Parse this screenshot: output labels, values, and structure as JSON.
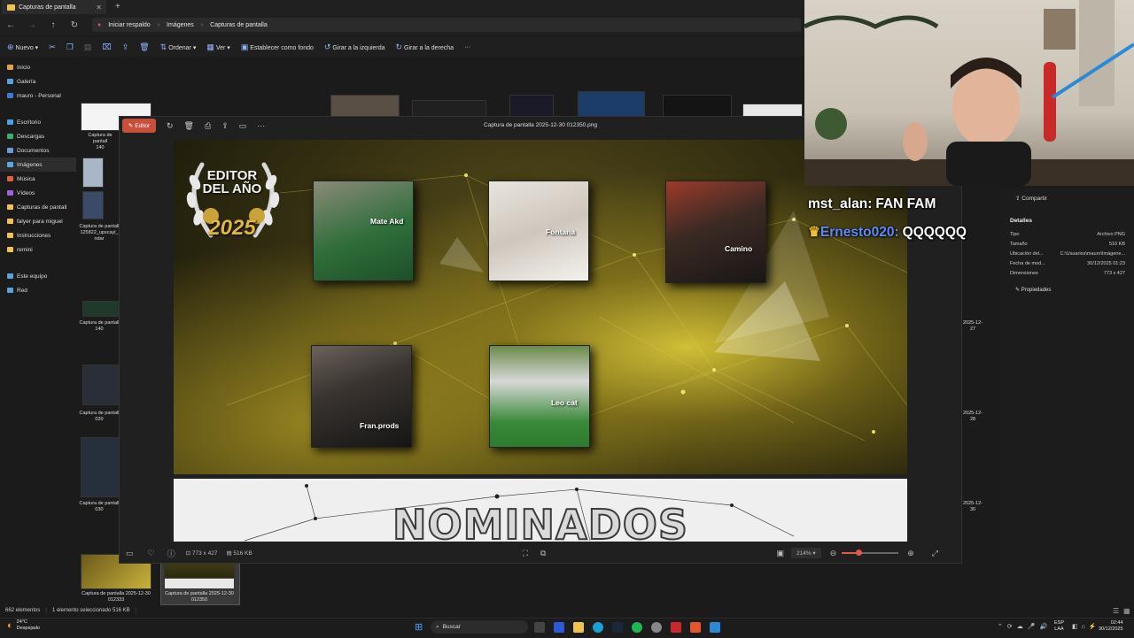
{
  "explorer": {
    "tab_title": "Capturas de pantalla",
    "breadcrumb": [
      "Iniciar respaldo",
      "Imágenes",
      "Capturas de pantalla"
    ],
    "toolbar": {
      "new": "Nuevo",
      "sort": "Ordenar",
      "view": "Ver",
      "set_background": "Establecer como fondo",
      "rotate_left": "Girar a la izquierda",
      "rotate_right": "Girar a la derecha",
      "more": "···"
    },
    "sidebar": [
      {
        "label": "Inicio",
        "color": "#e8a040"
      },
      {
        "label": "Galería",
        "color": "#5aa0e0"
      },
      {
        "label": "mauro - Personal",
        "color": "#3b78d8"
      },
      {
        "label": "Escritorio",
        "color": "#4aa0e8"
      },
      {
        "label": "Descargas",
        "color": "#3cb06a"
      },
      {
        "label": "Documentos",
        "color": "#6c9ad8"
      },
      {
        "label": "Imágenes",
        "color": "#58a8e8"
      },
      {
        "label": "Música",
        "color": "#e06040"
      },
      {
        "label": "Vídeos",
        "color": "#a060d8"
      },
      {
        "label": "Capturas de pantall",
        "color": "#f0c44c"
      },
      {
        "label": "falyer para miguel",
        "color": "#f0c44c"
      },
      {
        "label": "Instrucciones",
        "color": "#f0c44c"
      },
      {
        "label": "remini",
        "color": "#f0c44c"
      },
      {
        "label": "Este equipo",
        "color": "#5aa0e0"
      },
      {
        "label": "Red",
        "color": "#5aa0e0"
      }
    ],
    "file_labels": {
      "f1": "Captura de pantall",
      "f1b": "140",
      "f2": "Captura de pantall",
      "f2b": "125822_upscayl_",
      "f2c": "ndar",
      "f3": "Captura de pantall",
      "f3b": "140",
      "f4": "Captura de pantall",
      "f4b": "020",
      "f5": "Captura de pantall",
      "f5b": "030",
      "f6": "Captura de pantalla 2025-12-30",
      "f6b": "012333",
      "f7": "Captura de pantalla 2025-12-30",
      "f7b": "012350"
    },
    "right_dates": [
      "2025-12-27",
      "2025-12-28",
      "2025-12-30"
    ],
    "status": {
      "count": "662 elementos",
      "selected": "1 elemento seleccionado  516 KB"
    }
  },
  "viewer": {
    "editor_label": "Editor",
    "title": "Captura de pantalla 2025-12-30 012350.png",
    "dimensions": "773 x 427",
    "size": "516 KB",
    "zoom": "214%",
    "zoom_level": 0.3,
    "image": {
      "badge_line1": "EDITOR",
      "badge_line2": "DEL AÑO",
      "badge_year": "2025",
      "nominees": [
        "Mate Akd",
        "Fontana",
        "Camino",
        "Fran.prods",
        "Leo cat"
      ],
      "banner": "NOMINADOS"
    }
  },
  "details": {
    "share": "Compartir",
    "heading": "Detalles",
    "rows": [
      {
        "k": "Tipo",
        "v": "Archivo PNG"
      },
      {
        "k": "Tamaño",
        "v": "516 KB"
      },
      {
        "k": "Ubicación del...",
        "v": "C:\\Usuarios\\mauro\\Imágene..."
      },
      {
        "k": "Fecha de mod...",
        "v": "30/12/2025 01:23"
      },
      {
        "k": "Dimensiones",
        "v": "773 x 427"
      }
    ],
    "properties": "Propiedades"
  },
  "chat": [
    {
      "user": "mst_alan:",
      "msg": "FAN FAM",
      "user_color": "#ffffff"
    },
    {
      "user": "Ernesto020:",
      "msg": "QQQQQQ",
      "user_color": "#5a8cff"
    }
  ],
  "taskbar": {
    "weather_temp": "24°C",
    "weather_desc": "Despejado",
    "search": "Buscar",
    "lang1": "ESP",
    "lang2": "LAA",
    "time": "02:44",
    "date": "30/12/2025"
  }
}
